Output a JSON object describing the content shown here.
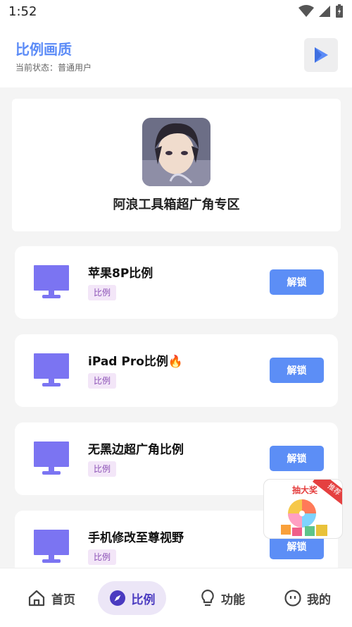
{
  "status_bar": {
    "time": "1:52"
  },
  "header": {
    "title": "比例画质",
    "subtitle": "当前状态：普通用户"
  },
  "profile": {
    "name": "阿浪工具箱超广角专区"
  },
  "items": [
    {
      "title": "苹果8P比例",
      "tag": "比例",
      "action": "解锁"
    },
    {
      "title": "iPad Pro比例",
      "title_emoji": "🔥",
      "tag": "比例",
      "action": "解锁"
    },
    {
      "title": "无黑边超广角比例",
      "tag": "比例",
      "action": "解锁"
    },
    {
      "title": "手机修改至尊视野",
      "tag": "比例",
      "action": "解锁"
    }
  ],
  "float_ad": {
    "title": "抽大奖",
    "badge": "推荐"
  },
  "bottom_nav": [
    {
      "label": "首页",
      "icon": "home-icon"
    },
    {
      "label": "比例",
      "icon": "compass-icon",
      "active": true
    },
    {
      "label": "功能",
      "icon": "bulb-icon"
    },
    {
      "label": "我的",
      "icon": "face-icon"
    }
  ],
  "colors": {
    "accent": "#5b8bf7",
    "button": "#5c8ef6",
    "monitor": "#7b74f2",
    "tag_bg": "#f3e6f8"
  }
}
